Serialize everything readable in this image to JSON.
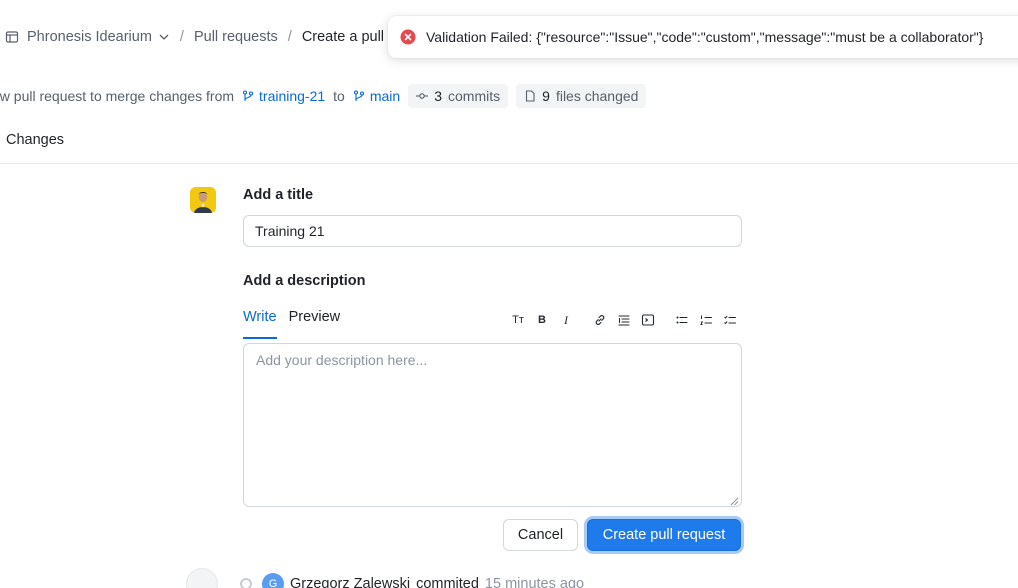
{
  "breadcrumb": {
    "repo": "Phronesis Idearium",
    "section": "Pull requests",
    "current": "Create a pull request"
  },
  "toast": {
    "message": "Validation Failed: {\"resource\":\"Issue\",\"code\":\"custom\",\"message\":\"must be a collaborator\"}",
    "icon": "error-circle-icon",
    "color": "#e5484d"
  },
  "merge": {
    "prefix": "ew pull request to merge changes from",
    "source_branch": "training-21",
    "connector": "to",
    "target_branch": "main",
    "commits_count": "3",
    "commits_label": "commits",
    "files_count": "9",
    "files_label": "files changed"
  },
  "tabs": {
    "changes_label": "Changes"
  },
  "form": {
    "title_label": "Add a title",
    "title_value": "Training 21",
    "description_label": "Add a description",
    "write_tab": "Write",
    "preview_tab": "Preview",
    "description_placeholder": "Add your description here...",
    "toolbar_heading": "Tт",
    "toolbar_bold": "B",
    "toolbar_italic": "I",
    "cancel_label": "Cancel",
    "create_label": "Create pull request"
  },
  "commit": {
    "avatar_initial": "G",
    "author": "Grzegorz Zalewski",
    "action": "commited",
    "time": "15 minutes ago"
  },
  "colors": {
    "accent": "#1f7aec",
    "link": "#0969da",
    "error": "#e5484d"
  }
}
